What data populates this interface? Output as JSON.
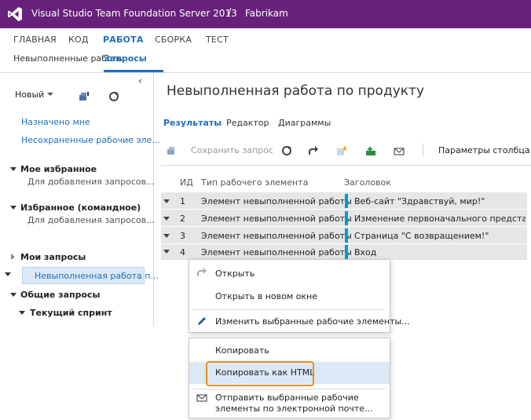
{
  "header": {
    "app_title": "Visual Studio Team Foundation Server 2013",
    "separator": "/",
    "project": "Fabrikam",
    "brand_color": "#68217a"
  },
  "hubs": {
    "home": "ГЛАВНАЯ",
    "code": "КОД",
    "work": "РАБОТА",
    "build": "СБОРКА",
    "test": "ТЕСТ"
  },
  "subnav": {
    "backlogs": "Невыполненные работы",
    "queries": "Запросы"
  },
  "sidebar": {
    "collapse_icon": "chevron-left-icon",
    "new_label": "Новый",
    "links": {
      "assigned": "Назначено мне",
      "unsaved": "Несохраненные рабочие эле..."
    },
    "my_favorites": {
      "title": "Мое избранное",
      "hint": "Для добавления запросов..."
    },
    "team_favorites": {
      "title": "Избранное (командное)",
      "hint": "Для добавления запросов..."
    },
    "my_queries": {
      "title": "Мои запросы",
      "selected": "Невыполненная работа п..."
    },
    "shared_queries": {
      "title": "Общие запросы",
      "current_sprint": "Текущий спринт"
    }
  },
  "main": {
    "title": "Невыполненная работа по продукту",
    "tabs": {
      "results": "Результаты",
      "editor": "Редактор",
      "charts": "Диаграммы"
    },
    "toolbar": {
      "save_query": "Сохранить запрос",
      "column_options": "Параметры столбца"
    },
    "grid": {
      "headers": {
        "id": "ИД",
        "type": "Тип рабочего элемента",
        "title": "Заголовок"
      },
      "rows": [
        {
          "id": "1",
          "type": "Элемент невыполненной работы",
          "title": "Веб-сайт \"Здравствуй, мир!\""
        },
        {
          "id": "2",
          "type": "Элемент невыполненной работы",
          "title": "Изменение первоначального представ..."
        },
        {
          "id": "3",
          "type": "Элемент невыполненной работы",
          "title": "Страница \"С возвращением!\""
        },
        {
          "id": "4",
          "type": "Элемент невыполненной работы",
          "title": "Вход"
        }
      ],
      "type_color": "#009ccc"
    }
  },
  "context_menu": {
    "open": "Открыть",
    "open_new_window": "Открыть в новом окне",
    "edit_selected": "Изменить выбранные рабочие элементы..."
  },
  "sub_menu": {
    "copy": "Копировать",
    "copy_html": "Копировать как HTML",
    "email_line1": "Отправить выбранные рабочие",
    "email_line2": "элементы по электронной почте...",
    "highlight_color": "#f08c1e"
  }
}
